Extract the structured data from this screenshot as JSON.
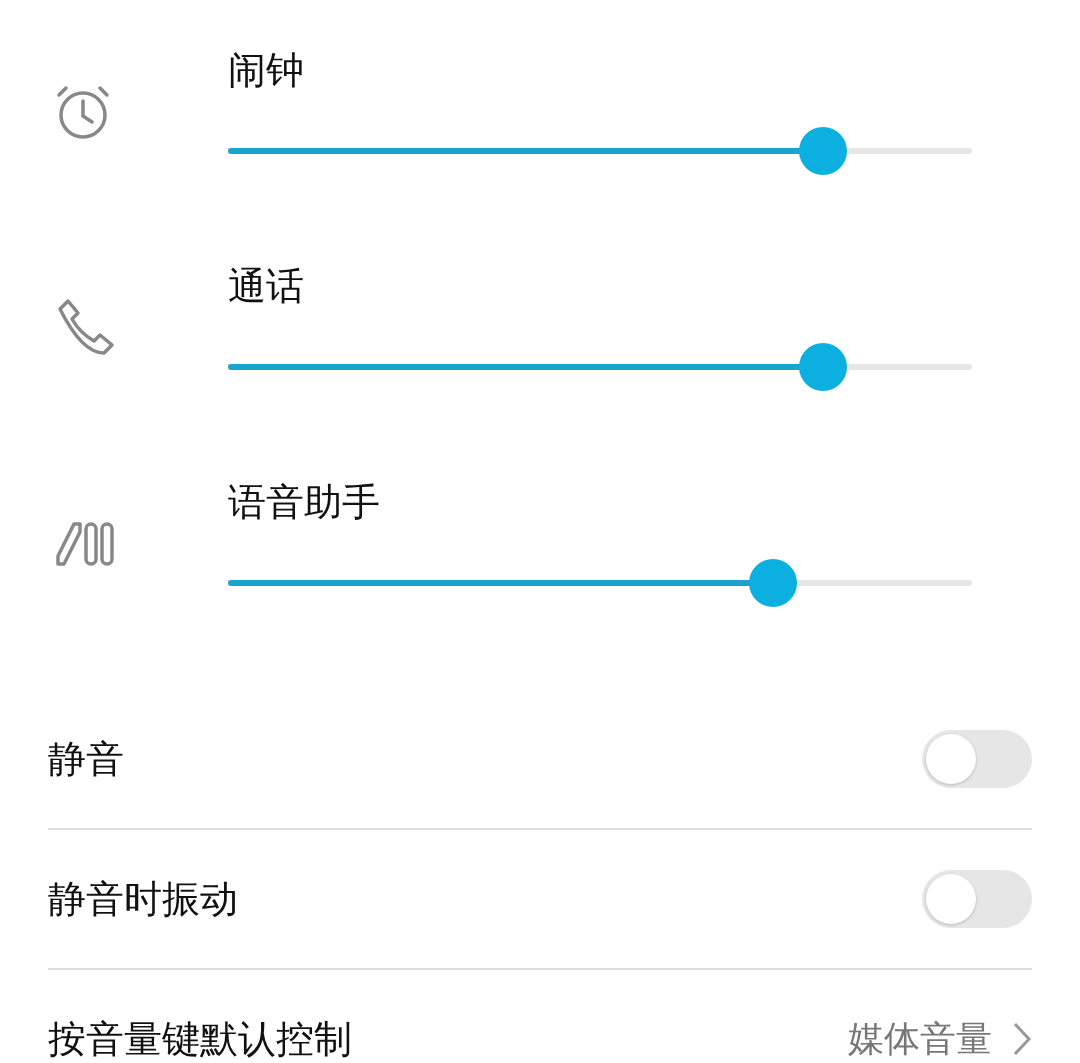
{
  "volume_sliders": [
    {
      "kind": "alarm",
      "label": "闹钟",
      "level": 0.8
    },
    {
      "kind": "call",
      "label": "通话",
      "level": 0.8
    },
    {
      "kind": "assistant",
      "label": "语音助手",
      "level": 0.733
    }
  ],
  "toggles": [
    {
      "label": "静音",
      "on": false
    },
    {
      "label": "静音时振动",
      "on": false
    }
  ],
  "volume_key_default": {
    "label": "按音量键默认控制",
    "value": "媒体音量"
  }
}
